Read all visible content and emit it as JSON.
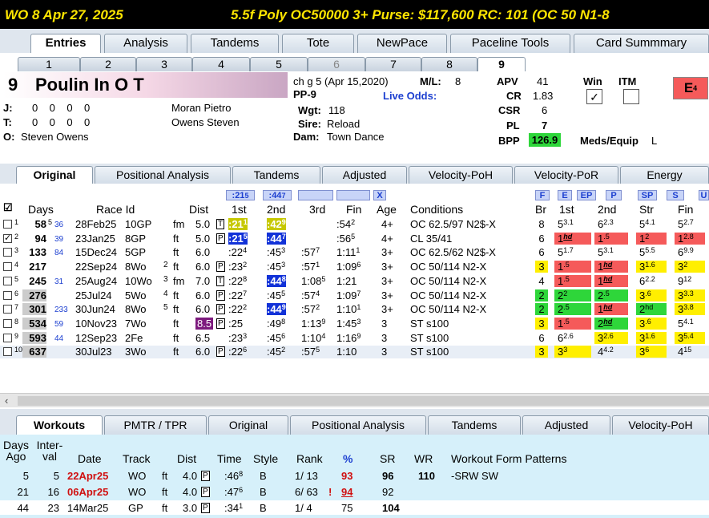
{
  "title_bar": {
    "race": "WO  8  Apr 27, 2025",
    "conditions": "5.5f  Poly  OC50000  3+   Purse: $117,600   RC: 101  (OC 50 N1-8"
  },
  "main_tabs": [
    "Entries",
    "Analysis",
    "Tandems",
    "Tote",
    "NewPace",
    "Paceline Tools",
    "Card Summmary"
  ],
  "main_tab_active": 0,
  "runner_tabs": [
    "1",
    "2",
    "3",
    "4",
    "5",
    "6",
    "7",
    "8",
    "9"
  ],
  "runner_tab_active": 8,
  "horse": {
    "program": "9",
    "name": "Poulin In O T",
    "jockey_label": "J:",
    "jockey_stats": "0    0    0    0",
    "jockey_name": "Moran Pietro",
    "trainer_label": "T:",
    "trainer_stats": "0    0    0    0",
    "trainer_name": "Owens Steven",
    "owner_label": "O:",
    "owner_name": "Steven Owens",
    "description": "ch g 5 (Apr 15,2020)",
    "ml_label": "M/L:",
    "ml_value": "8",
    "pp": "PP-9",
    "live_odds_label": "Live Odds:",
    "wgt_label": "Wgt:",
    "wgt": "118",
    "sire_label": "Sire:",
    "sire": "Reload",
    "dam_label": "Dam:",
    "dam": "Town Dance",
    "apv_label": "APV",
    "apv": "41",
    "cr_label": "CR",
    "cr": "1.83",
    "csr_label": "CSR",
    "csr": "6",
    "pl_label": "PL",
    "pl": "7",
    "bpp_label": "BPP",
    "bpp": "126.9",
    "win_label": "Win",
    "itm_label": "ITM",
    "meds_label": "Meds/Equip",
    "meds": "L",
    "e_badge": "E",
    "e_sup": "4"
  },
  "sub_tabs": [
    "Original",
    "Positional Analysis",
    "Tandems",
    "Adjusted",
    "Velocity-PoH",
    "Velocity-PoR",
    "Energy"
  ],
  "sub_tab_active": 0,
  "pp_header": {
    "days": "Days",
    "race_id": "Race Id",
    "dist": "Dist",
    "first": "1st",
    "second": "2nd",
    "third": "3rd",
    "fin": "Fin",
    "age": "Age",
    "conditions": "Conditions",
    "br": "Br",
    "c1st": "1st",
    "c2nd": "2nd",
    "str": "Str",
    "cfin": "Fin",
    "top_first": ":21",
    "top_first_sup": "5",
    "top_second": ":44",
    "top_second_sup": "7",
    "top_x": "X",
    "tag_f": "F",
    "tag_e": "E",
    "tag_ep": "EP",
    "tag_p": "P",
    "tag_sp": "SP",
    "tag_s": "S",
    "tag_u": "U"
  },
  "pp_rows": [
    {
      "n": "1",
      "days": "58",
      "days_sup": "5",
      "gap": "36",
      "date": "28Feb25",
      "race": "10GP",
      "surf": "fm",
      "dist": "5.0",
      "ty": "T",
      "c1": ":21",
      "c1s": "1",
      "c2": ":42",
      "c2s": "9",
      "c3": "",
      "fin": ":54",
      "fins": "2",
      "age": "4+",
      "cond": "OC 62.5/97 N2$-X",
      "br": "8",
      "p1": "5",
      "p1s": "3.1",
      "p2": "6",
      "p2s": "2.3",
      "ps": "5",
      "pss": "4.1",
      "pf": "5",
      "pfs": "2.7",
      "checked": false
    },
    {
      "n": "2",
      "days": "94",
      "days_sup": "",
      "gap": "39",
      "date": "23Jan25",
      "race": "8GP",
      "surf": "ft",
      "dist": "5.0",
      "ty": "P",
      "c1": ":21",
      "c1s": "5",
      "c2": ":44",
      "c2s": "7",
      "c3": "",
      "fin": ":56",
      "fins": "5",
      "age": "4+",
      "cond": "CL 35/41",
      "br": "6",
      "p1": "1",
      "p1s": "hd",
      "p2": "1",
      "p2s": ".5",
      "ps": "1",
      "pss": "2",
      "pf": "1",
      "pfs": "2.8",
      "checked": true
    },
    {
      "n": "3",
      "days": "133",
      "days_sup": "",
      "gap": "84",
      "date": "15Dec24",
      "race": "5GP",
      "surf": "ft",
      "dist": "6.0",
      "ty": "",
      "c1": ":22",
      "c1s": "4",
      "c2": ":45",
      "c2s": "3",
      "c3": ":57",
      "c3s": "7",
      "fin": "1:11",
      "fins": "1",
      "age": "3+",
      "cond": "OC 62.5/62 N2$-X",
      "br": "6",
      "p1": "5",
      "p1s": "1.7",
      "p2": "5",
      "p2s": "3.1",
      "ps": "5",
      "pss": "5.5",
      "pf": "6",
      "pfs": "9.9",
      "checked": false
    },
    {
      "n": "4",
      "days": "217",
      "days_sup": "",
      "gap": "",
      "date": "22Sep24",
      "race": "8Wo",
      "extra": "2",
      "surf": "ft",
      "dist": "6.0",
      "ty": "P",
      "c1": ":23",
      "c1s": "2",
      "c2": ":45",
      "c2s": "3",
      "c3": ":57",
      "c3s": "1",
      "fin": "1:09",
      "fins": "6",
      "age": "3+",
      "cond": "OC 50/114 N2-X",
      "br": "3",
      "p1": "1",
      "p1s": ".5",
      "p2": "1",
      "p2s": "hd",
      "ps": "3",
      "pss": "1.6",
      "pf": "3",
      "pfs": "2",
      "checked": false
    },
    {
      "n": "5",
      "days": "245",
      "days_sup": "",
      "gap": "31",
      "date": "25Aug24",
      "race": "10Wo",
      "extra": "3",
      "surf": "fm",
      "dist": "7.0",
      "ty": "T",
      "c1": ":22",
      "c1s": "8",
      "c2": ":44",
      "c2s": "8",
      "c3": "1:08",
      "c3s": "5",
      "fin": "1:21",
      "fins": "",
      "age": "3+",
      "cond": "OC 50/114 N2-X",
      "br": "4",
      "p1": "1",
      "p1s": ".5",
      "p2": "1",
      "p2s": "hd",
      "ps": "6",
      "pss": "2.2",
      "pf": "9",
      "pfs": "12",
      "checked": false
    },
    {
      "n": "6",
      "days": "276",
      "days_sup": "",
      "gap": "",
      "date": "25Jul24",
      "race": "5Wo",
      "extra": "4",
      "surf": "ft",
      "dist": "6.0",
      "ty": "P",
      "c1": ":22",
      "c1s": "7",
      "c2": ":45",
      "c2s": "5",
      "c3": ":57",
      "c3s": "4",
      "fin": "1:09",
      "fins": "7",
      "age": "3+",
      "cond": "OC 50/114 N2-X",
      "br": "2",
      "p1": "2",
      "p1s": "2",
      "p2": "2",
      "p2s": ".5",
      "ps": "3",
      "pss": ".6",
      "pf": "3",
      "pfs": "3.3",
      "checked": false
    },
    {
      "n": "7",
      "days": "301",
      "days_sup": "",
      "gap": "233",
      "date": "30Jun24",
      "race": "8Wo",
      "extra": "5",
      "surf": "ft",
      "dist": "6.0",
      "ty": "P",
      "c1": ":22",
      "c1s": "2",
      "c2": ":44",
      "c2s": "9",
      "c3": ":57",
      "c3s": "2",
      "fin": "1:10",
      "fins": "1",
      "age": "3+",
      "cond": "OC 50/114 N2-X",
      "br": "2",
      "p1": "2",
      "p1s": ".5",
      "p2": "1",
      "p2s": "hd",
      "ps": "2",
      "pss": "hd",
      "pf": "3",
      "pfs": "3.8",
      "checked": false
    },
    {
      "n": "8",
      "days": "534",
      "days_sup": "",
      "gap": "59",
      "date": "10Nov23",
      "race": "7Wo",
      "surf": "ft",
      "dist": "8.5",
      "ty": "P",
      "c1": ":25",
      "c1s": "",
      "c2": ":49",
      "c2s": "8",
      "c3": "1:13",
      "c3s": "9",
      "fin": "1:45",
      "fins": "3",
      "age": "3",
      "cond": "ST s100",
      "br": "3",
      "p1": "1",
      "p1s": ".5",
      "p2": "2",
      "p2s": "hd",
      "ps": "3",
      "pss": ".6",
      "pf": "5",
      "pfs": "4.1",
      "checked": false
    },
    {
      "n": "9",
      "days": "593",
      "days_sup": "",
      "gap": "44",
      "date": "12Sep23",
      "race": "2Fe",
      "surf": "ft",
      "dist": "6.5",
      "ty": "",
      "c1": ":23",
      "c1s": "3",
      "c2": ":45",
      "c2s": "6",
      "c3": "1:10",
      "c3s": "4",
      "fin": "1:16",
      "fins": "9",
      "age": "3",
      "cond": "ST s100",
      "br": "6",
      "p1": "6",
      "p1s": "2.6",
      "p2": "3",
      "p2s": "2.6",
      "ps": "3",
      "pss": "1.6",
      "pf": "3",
      "pfs": "5.4",
      "checked": false
    },
    {
      "n": "10",
      "days": "637",
      "days_sup": "",
      "gap": "",
      "date": "30Jul23",
      "race": "3Wo",
      "surf": "ft",
      "dist": "6.0",
      "ty": "P",
      "c1": ":22",
      "c1s": "6",
      "c2": ":45",
      "c2s": "2",
      "c3": ":57",
      "c3s": "5",
      "fin": "1:10",
      "fins": "",
      "age": "3",
      "cond": "ST s100",
      "br": "3",
      "p1": "3",
      "p1s": "3",
      "p2": "4",
      "p2s": "4.2",
      "ps": "3",
      "pss": "6",
      "pf": "4",
      "pfs": "15",
      "checked": false
    }
  ],
  "workout_tabs": [
    "Workouts",
    "PMTR / TPR",
    "Original",
    "Positional Analysis",
    "Tandems",
    "Adjusted",
    "Velocity-PoH"
  ],
  "workout_tab_active": 0,
  "workout_header": {
    "days_ago": "Days Ago",
    "interval": "Inter- val",
    "date": "Date",
    "track": "Track",
    "dist": "Dist",
    "time": "Time",
    "style": "Style",
    "rank": "Rank",
    "pct": "%",
    "sr": "SR",
    "wr": "WR",
    "patterns": "Workout Form Patterns"
  },
  "workouts": [
    {
      "days": "5",
      "interval": "5",
      "date": "22Apr25",
      "track": "WO",
      "surf": "ft",
      "dist": "4.0",
      "ty": "P",
      "time": ":46",
      "time_sup": "8",
      "style": "B",
      "rank": "1/ 13",
      "bang": "",
      "pct": "93",
      "sr": "96",
      "wr": "110",
      "patterns": "-SRW  SW"
    },
    {
      "days": "21",
      "interval": "16",
      "date": "06Apr25",
      "track": "WO",
      "surf": "ft",
      "dist": "4.0",
      "ty": "P",
      "time": ":47",
      "time_sup": "6",
      "style": "B",
      "rank": "6/ 63",
      "bang": "!",
      "pct": "94",
      "sr": "92",
      "wr": "",
      "patterns": ""
    },
    {
      "days": "44",
      "interval": "23",
      "date": "14Mar25",
      "track": "GP",
      "surf": "ft",
      "dist": "3.0",
      "ty": "P",
      "time": ":34",
      "time_sup": "1",
      "style": "B",
      "rank": "1/ 4",
      "bang": "",
      "pct": "75",
      "sr": "104",
      "wr": "",
      "patterns": ""
    }
  ]
}
